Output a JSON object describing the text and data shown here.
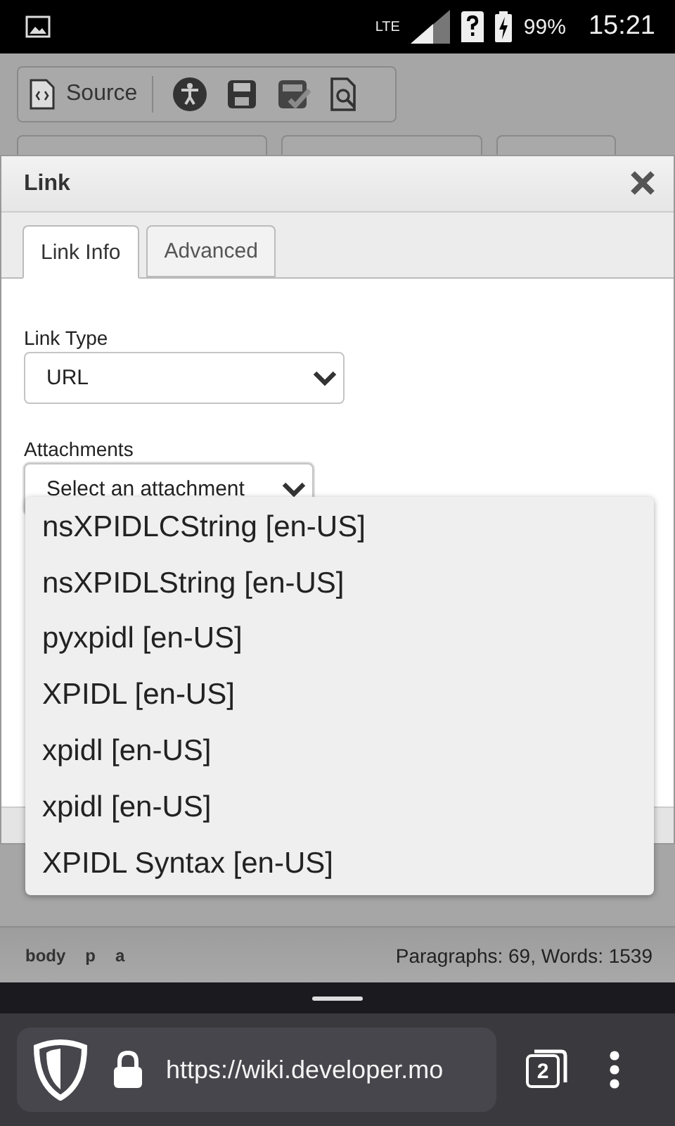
{
  "status_bar": {
    "network": "LTE",
    "battery": "99%",
    "time": "15:21"
  },
  "toolbar": {
    "source_button": "Source"
  },
  "dialog": {
    "title": "Link",
    "tabs": [
      {
        "label": "Link Info",
        "selected": true
      },
      {
        "label": "Advanced",
        "selected": false
      }
    ],
    "fields": [
      {
        "label": "Link Type",
        "value": "URL",
        "expanded": false
      },
      {
        "label": "Attachments",
        "value": "Select an attachment",
        "expanded": true
      }
    ]
  },
  "dropdown": {
    "options": [
      "nsXPIDLCString [en-US]",
      "nsXPIDLString [en-US]",
      "pyxpidl [en-US]",
      "XPIDL [en-US]",
      "xpidl [en-US]",
      "xpidl [en-US]",
      "XPIDL Syntax [en-US]"
    ]
  },
  "editor_status": {
    "path": [
      "body",
      "p",
      "a"
    ],
    "counts": "Paragraphs: 69, Words: 1539"
  },
  "browser": {
    "url": "https://wiki.developer.mo",
    "tab_count": "2"
  }
}
